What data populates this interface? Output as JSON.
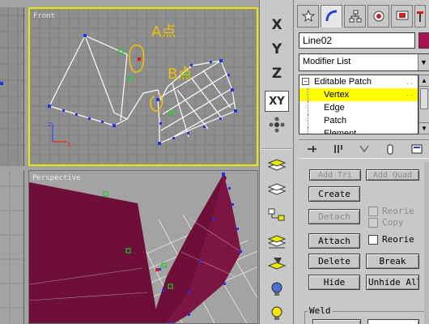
{
  "viewports": {
    "front": {
      "label": "Front"
    },
    "perspective": {
      "label": "Perspective"
    }
  },
  "annotations": {
    "point_a": "A点",
    "point_b": "B点"
  },
  "nav": {
    "x": "X",
    "y": "Y",
    "z": "Z",
    "xy": "XY"
  },
  "panel": {
    "object_name": "Line02",
    "object_color": "#a8124f",
    "modifier_list": "Modifier List",
    "stack": [
      {
        "label": "Editable Patch",
        "level": 0,
        "selected": false
      },
      {
        "label": "Vertex",
        "level": 1,
        "selected": true
      },
      {
        "label": "Edge",
        "level": 1,
        "selected": false
      },
      {
        "label": "Patch",
        "level": 1,
        "selected": false
      },
      {
        "label": "Element",
        "level": 1,
        "selected": false
      }
    ],
    "buttons": {
      "add_tri": "Add Tri",
      "add_quad": "Add Quad",
      "create": "Create",
      "detach": "Detach",
      "attach": "Attach",
      "delete": "Delete",
      "break": "Break",
      "hide": "Hide",
      "unhide_all": "Unhide All"
    },
    "checkboxes": {
      "reorient_top": "Reorie",
      "copy": "Copy",
      "reorient": "Reorie"
    },
    "weld_group": "Weld"
  },
  "colors": {
    "selection": "#ffff00",
    "patch": "#6e0f3a",
    "vertex": "#2233ee",
    "annotation": "#f0c000"
  }
}
